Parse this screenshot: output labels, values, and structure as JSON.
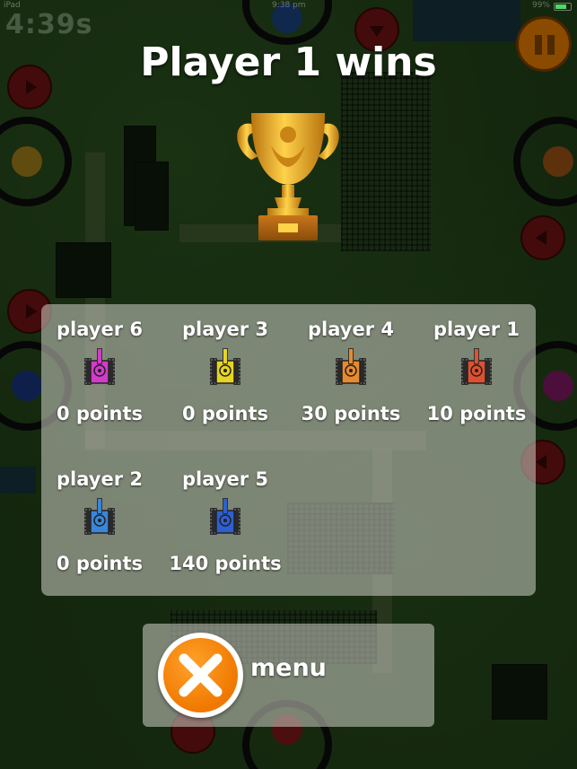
{
  "status_bar": {
    "carrier": "iPad",
    "clock": "9:38 pm",
    "battery": "99%"
  },
  "hud": {
    "timer": "4:39s"
  },
  "result": {
    "title": "Player 1 wins"
  },
  "icons": {
    "trophy": "trophy-icon",
    "tank": "tank-icon",
    "close": "close-icon",
    "pause": "pause-icon"
  },
  "players": [
    {
      "name": "player 6",
      "points": "0 points",
      "tank_color": "#d23cc8"
    },
    {
      "name": "player 3",
      "points": "0 points",
      "tank_color": "#e6d422"
    },
    {
      "name": "player 4",
      "points": "30 points",
      "tank_color": "#e88a2c"
    },
    {
      "name": "player 1",
      "points": "10 points",
      "tank_color": "#e0502e"
    },
    {
      "name": "player 2",
      "points": "0 points",
      "tank_color": "#3a86d8"
    },
    {
      "name": "player 5",
      "points": "140 points",
      "tank_color": "#2f5fd0"
    }
  ],
  "menu": {
    "label": "menu"
  },
  "colors": {
    "panel": "#d2d2c8",
    "accent_orange": "#f07800",
    "trophy_gold": "#e8a62a"
  }
}
